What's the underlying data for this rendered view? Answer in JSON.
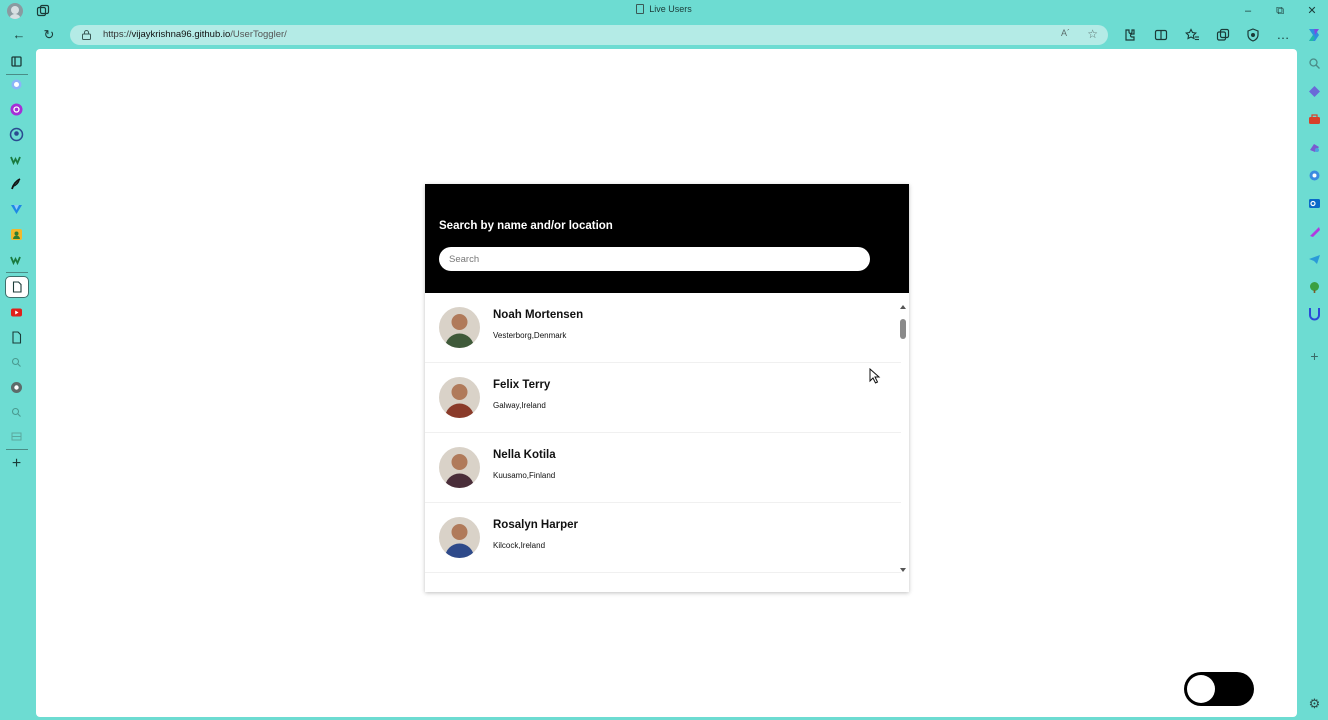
{
  "browser": {
    "tab_title": "Live Users",
    "url_prefix": "https://",
    "url_host": "vijaykrishna96.github.io",
    "url_path": "/UserToggler/",
    "read_aloud": "A´",
    "favorite_glyph": "☆",
    "minimize_glyph": "–",
    "restore_glyph": "⧉",
    "close_glyph": "✕",
    "back_glyph": "←",
    "refresh_glyph": "↻",
    "more_glyph": "…",
    "add_glyph": "+",
    "settings_glyph": "⚙"
  },
  "panel": {
    "heading": "Search by name and/or location",
    "search_placeholder": "Search",
    "search_value": ""
  },
  "users": [
    {
      "name": "Noah Mortensen",
      "location": "Vesterborg,Denmark",
      "avatar_color": "#3f5a3a"
    },
    {
      "name": "Felix Terry",
      "location": "Galway,Ireland",
      "avatar_color": "#8a3b2a"
    },
    {
      "name": "Nella Kotila",
      "location": "Kuusamo,Finland",
      "avatar_color": "#4a2e3a"
    },
    {
      "name": "Rosalyn Harper",
      "location": "Kilcock,Ireland",
      "avatar_color": "#2e4a8a"
    }
  ],
  "theme_toggle": {
    "state": "off"
  },
  "icons": {
    "vertical_tabs": [
      "tab-overview-icon",
      "copilot-icon",
      "instagram-icon",
      "github-icon",
      "whatsapp-icon",
      "feather-icon",
      "vuetify-icon",
      "contacts-icon",
      "whatsapp-icon-2",
      "document-icon",
      "youtube-icon",
      "document-icon-2",
      "search-icon",
      "chrome-icon",
      "search-icon-2",
      "grid-icon",
      "add-tab-icon"
    ],
    "right_sidebar": [
      "search-icon",
      "gem-icon",
      "toolbox-icon",
      "games-icon",
      "copilot-icon",
      "outlook-icon",
      "designer-icon",
      "telegram-icon",
      "tree-icon",
      "upwork-icon",
      "add-icon",
      "settings-icon"
    ]
  }
}
